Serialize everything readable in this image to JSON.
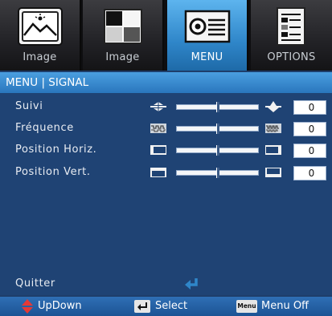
{
  "tabs": [
    {
      "label": "Image",
      "icon": "image-landscape-icon",
      "active": false
    },
    {
      "label": "Image",
      "icon": "image-contrast-icon",
      "active": false
    },
    {
      "label": "MENU",
      "icon": "projector-icon",
      "active": true
    },
    {
      "label": "OPTIONS",
      "icon": "options-settings-icon",
      "active": false
    }
  ],
  "breadcrumb": "MENU | SIGNAL",
  "rows": [
    {
      "label": "Suivi",
      "value": "0",
      "level": 0.5,
      "icon_minus": "tracking-minus-icon",
      "icon_plus": "tracking-plus-icon"
    },
    {
      "label": "Fréquence",
      "value": "0",
      "level": 0.5,
      "icon_minus": "frequency-minus-icon",
      "icon_plus": "frequency-plus-icon"
    },
    {
      "label": "Position Horiz.",
      "value": "0",
      "level": 0.5,
      "icon_minus": "h-position-left-icon",
      "icon_plus": "h-position-right-icon"
    },
    {
      "label": "Position Vert.",
      "value": "0",
      "level": 0.5,
      "icon_minus": "v-position-down-icon",
      "icon_plus": "v-position-up-icon"
    }
  ],
  "quit": {
    "label": "Quitter",
    "icon": "enter-return-icon"
  },
  "footer": {
    "updown": {
      "icon": "up-down-arrows-icon",
      "label": "UpDown"
    },
    "select": {
      "icon": "enter-key-icon",
      "label": "Select"
    },
    "menu_off": {
      "icon": "menu-key-icon",
      "key_text": "Menu",
      "label": "Menu Off"
    }
  },
  "colors": {
    "panel": "#1f4374",
    "title_bar": "#3a8ad0",
    "tab_active": "#2f86c9",
    "tab_inactive": "#2a2a2e",
    "footer": "#2563a8",
    "updown_icon": "#e53935",
    "enter_icon": "#2f86c9"
  }
}
